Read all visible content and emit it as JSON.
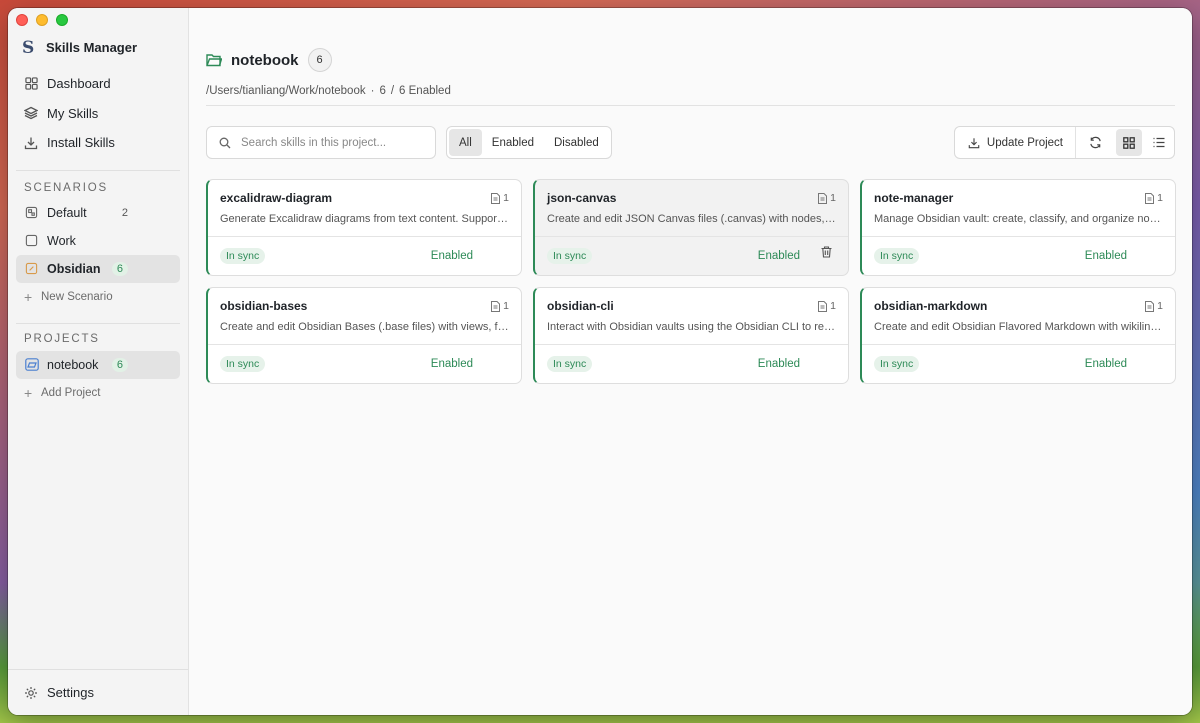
{
  "app": {
    "name": "Skills Manager",
    "logo": "S"
  },
  "nav": [
    {
      "label": "Dashboard",
      "icon": "dashboard-icon"
    },
    {
      "label": "My Skills",
      "icon": "layers-icon"
    },
    {
      "label": "Install Skills",
      "icon": "download-icon"
    }
  ],
  "scenarios": {
    "title": "SCENARIOS",
    "items": [
      {
        "label": "Default",
        "count": "2"
      },
      {
        "label": "Work",
        "count": ""
      },
      {
        "label": "Obsidian",
        "count": "6"
      }
    ],
    "add_label": "New Scenario"
  },
  "projects": {
    "title": "PROJECTS",
    "items": [
      {
        "label": "notebook",
        "count": "6"
      }
    ],
    "add_label": "Add Project"
  },
  "settings_label": "Settings",
  "header": {
    "title": "notebook",
    "count": "6",
    "path": "/Users/tianliang/Work/notebook",
    "sep": "·",
    "enabled_count": "6",
    "slash": "/",
    "enabled_text": "6 Enabled"
  },
  "search": {
    "placeholder": "Search skills in this project..."
  },
  "filters": [
    "All",
    "Enabled",
    "Disabled"
  ],
  "update_label": "Update Project",
  "colors": {
    "accent": "#2d8a57",
    "badge_bg": "#e6f2ea"
  },
  "cards": [
    {
      "name": "excalidraw-diagram",
      "files": "1",
      "desc": "Generate Excalidraw diagrams from text content. Supports three output modes",
      "sync": "In sync",
      "status": "Enabled"
    },
    {
      "name": "json-canvas",
      "files": "1",
      "desc": "Create and edit JSON Canvas files (.canvas) with nodes, edges, groups",
      "sync": "In sync",
      "status": "Enabled"
    },
    {
      "name": "note-manager",
      "files": "1",
      "desc": "Manage Obsidian vault: create, classify, and organize notes",
      "sync": "In sync",
      "status": "Enabled"
    },
    {
      "name": "obsidian-bases",
      "files": "1",
      "desc": "Create and edit Obsidian Bases (.base files) with views, filters",
      "sync": "In sync",
      "status": "Enabled"
    },
    {
      "name": "obsidian-cli",
      "files": "1",
      "desc": "Interact with Obsidian vaults using the Obsidian CLI to read, create",
      "sync": "In sync",
      "status": "Enabled"
    },
    {
      "name": "obsidian-markdown",
      "files": "1",
      "desc": "Create and edit Obsidian Flavored Markdown with wikilinks, embeds",
      "sync": "In sync",
      "status": "Enabled"
    }
  ]
}
